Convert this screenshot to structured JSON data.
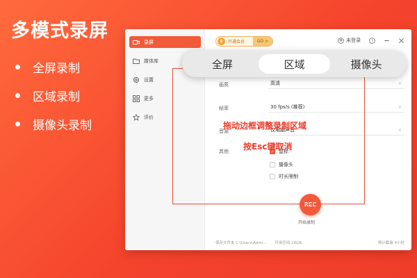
{
  "promo": {
    "title": "多模式录屏",
    "features": [
      "全屏录制",
      "区域录制",
      "摄像头录制"
    ]
  },
  "sidebar": {
    "items": [
      {
        "label": "录屏",
        "icon": "video-camera-icon",
        "active": true
      },
      {
        "label": "媒体库",
        "icon": "folder-icon",
        "active": false
      },
      {
        "label": "设置",
        "icon": "gear-icon",
        "active": false
      },
      {
        "label": "更多",
        "icon": "grid-icon",
        "active": false
      },
      {
        "label": "评价",
        "icon": "star-icon",
        "active": false
      }
    ]
  },
  "topbar": {
    "vip_label": "开通会员",
    "vip_go": "GO >",
    "login_label": "未登录"
  },
  "mode_tabs": [
    "全屏",
    "区域",
    "摄像头"
  ],
  "active_mode": "区域",
  "settings": {
    "quality_label": "画质",
    "quality_value": "高清",
    "framerate_label": "帧率",
    "framerate_value": "30 fps/s (推荐)",
    "sound_label": "音源",
    "sound_value": "仅电脑声音",
    "other_label": "其他",
    "options": [
      {
        "label": "鼠标",
        "checked": true
      },
      {
        "label": "摄像头",
        "checked": false
      },
      {
        "label": "时长限制",
        "checked": false
      }
    ]
  },
  "record": {
    "button_label": "REC",
    "caption": "开始录制"
  },
  "status": {
    "save_folder": "保存文件夹   C:\\Users\\Admi...",
    "free_space": "可用空间   26GB",
    "estimated": "预计截录   4小时"
  },
  "overlay": {
    "hint_drag": "拖动边框调整录制区域",
    "hint_esc": "按Esc键取消"
  },
  "colors": {
    "accent": "#f35a3a",
    "background": "#f5442c",
    "hint_text": "#ef3a2a"
  }
}
